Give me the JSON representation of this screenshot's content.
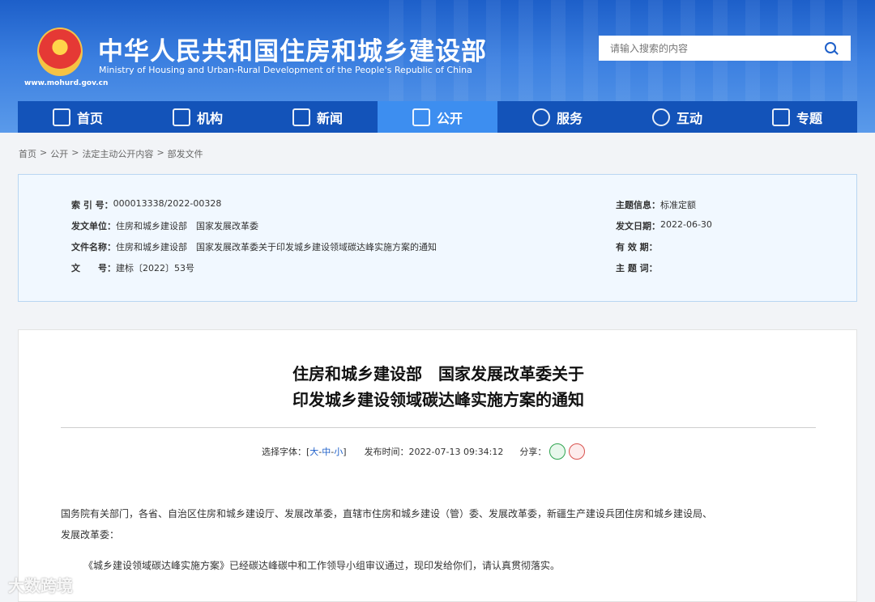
{
  "header": {
    "title": "中华人民共和国住房和城乡建设部",
    "subtitle": "Ministry of Housing and Urban-Rural Development of the People's Republic of China",
    "url": "www.mohurd.gov.cn"
  },
  "search": {
    "placeholder": "请输入搜索的内容"
  },
  "nav": [
    {
      "label": "首页"
    },
    {
      "label": "机构"
    },
    {
      "label": "新闻"
    },
    {
      "label": "公开"
    },
    {
      "label": "服务"
    },
    {
      "label": "互动"
    },
    {
      "label": "专题"
    }
  ],
  "breadcrumb": [
    "首页",
    ">",
    "公开",
    ">",
    "法定主动公开内容",
    ">",
    "部发文件"
  ],
  "meta": {
    "index_label": "索 引 号：",
    "index_value": "000013338/2022-00328",
    "issuer_label": "发文单位：",
    "issuer_value": "住房和城乡建设部　国家发展改革委",
    "file_label": "文件名称：",
    "file_value": "住房和城乡建设部　国家发展改革委关于印发城乡建设领域碳达峰实施方案的通知",
    "number_label": "文　　号：",
    "number_value": "建标〔2022〕53号",
    "topic_label": "主题信息：",
    "topic_value": "标准定额",
    "date_label": "发文日期：",
    "date_value": "2022-06-30",
    "valid_label": "有 效 期：",
    "keyword_label": "主 题 词："
  },
  "article": {
    "title_line1": "住房和城乡建设部　国家发展改革委关于",
    "title_line2": "印发城乡建设领域碳达峰实施方案的通知",
    "font_label": "选择字体：[",
    "font_big": "大",
    "font_sep1": " - ",
    "font_mid": "中",
    "font_sep2": " - ",
    "font_small": "小",
    "font_end": "]",
    "publish_label": "发布时间：2022-07-13 09:34:12",
    "share_label": "分享：",
    "para1_line1": "国务院有关部门，各省、自治区住房和城乡建设厅、发展改革委，直辖市住房和城乡建设（管）委、发展改革委，新疆生产建设兵团住房和城乡建设局、",
    "para1_line2": "发展改革委：",
    "para2": "《城乡建设领域碳达峰实施方案》已经碳达峰碳中和工作领导小组审议通过，现印发给你们，请认真贯彻落实。"
  },
  "watermark": "大数跨境"
}
